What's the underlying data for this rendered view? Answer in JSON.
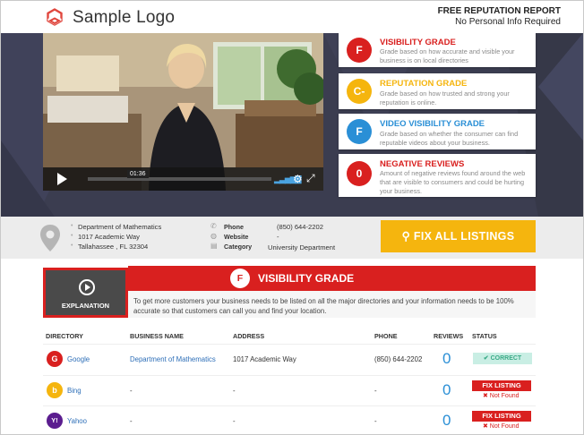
{
  "header": {
    "logo_text": "Sample Logo",
    "report_title": "FREE REPUTATION REPORT",
    "report_subtitle": "No Personal Info Required"
  },
  "video": {
    "time": "01:36",
    "volume_bars": "▂▃▅▆▇"
  },
  "grades": [
    {
      "letter": "F",
      "title": "VISIBILITY GRADE",
      "color": "#d9201f",
      "desc": "Grade based on how accurate and visible your business is on local directories"
    },
    {
      "letter": "C-",
      "title": "REPUTATION GRADE",
      "color": "#f5b50e",
      "desc": "Grade based on how trusted and strong your reputation is online."
    },
    {
      "letter": "F",
      "title": "VIDEO VISIBILITY GRADE",
      "color": "#2a8fd6",
      "desc": "Grade based on whether the consumer can find reputable videos about your business."
    },
    {
      "letter": "0",
      "title": "NEGATIVE REVIEWS",
      "color": "#d9201f",
      "desc": "Amount of negative reviews found around the web that are visible to consumers and could be hurting your business."
    }
  ],
  "business": {
    "address_lines": [
      "Department of Mathematics",
      "1017 Academic Way",
      "Tallahassee , FL 32304"
    ],
    "phone_label": "Phone",
    "phone": "(850) 644-2202",
    "website_label": "Website",
    "website": "-",
    "category_label": "Category",
    "category": "University Department"
  },
  "fix_all_label": "FIX ALL LISTINGS",
  "visibility": {
    "thumb_label": "EXPLANATION",
    "letter": "F",
    "title": "VISIBILITY GRADE",
    "description": "To get more customers your business needs to be listed on all the major directories and your information needs to be 100% accurate so that customers can call you and find your location."
  },
  "table": {
    "headers": [
      "DIRECTORY",
      "BUSINESS NAME",
      "ADDRESS",
      "PHONE",
      "REVIEWS",
      "STATUS"
    ],
    "rows": [
      {
        "directory": "Google",
        "icon": "G",
        "icon_color": "#d9201f",
        "name": "Department of Mathematics",
        "address": "1017 Academic Way",
        "phone": "(850) 644-2202",
        "reviews": "0",
        "status": "✔ CORRECT",
        "status_sub": ""
      },
      {
        "directory": "Bing",
        "icon": "b",
        "icon_color": "#f5b50e",
        "name": "-",
        "address": "-",
        "phone": "-",
        "reviews": "0",
        "status": "FIX LISTING",
        "status_sub": "✖ Not Found"
      },
      {
        "directory": "Yahoo",
        "icon": "Y!",
        "icon_color": "#5b1d8f",
        "name": "-",
        "address": "-",
        "phone": "-",
        "reviews": "0",
        "status": "FIX LISTING",
        "status_sub": "✖ Not Found"
      }
    ]
  }
}
